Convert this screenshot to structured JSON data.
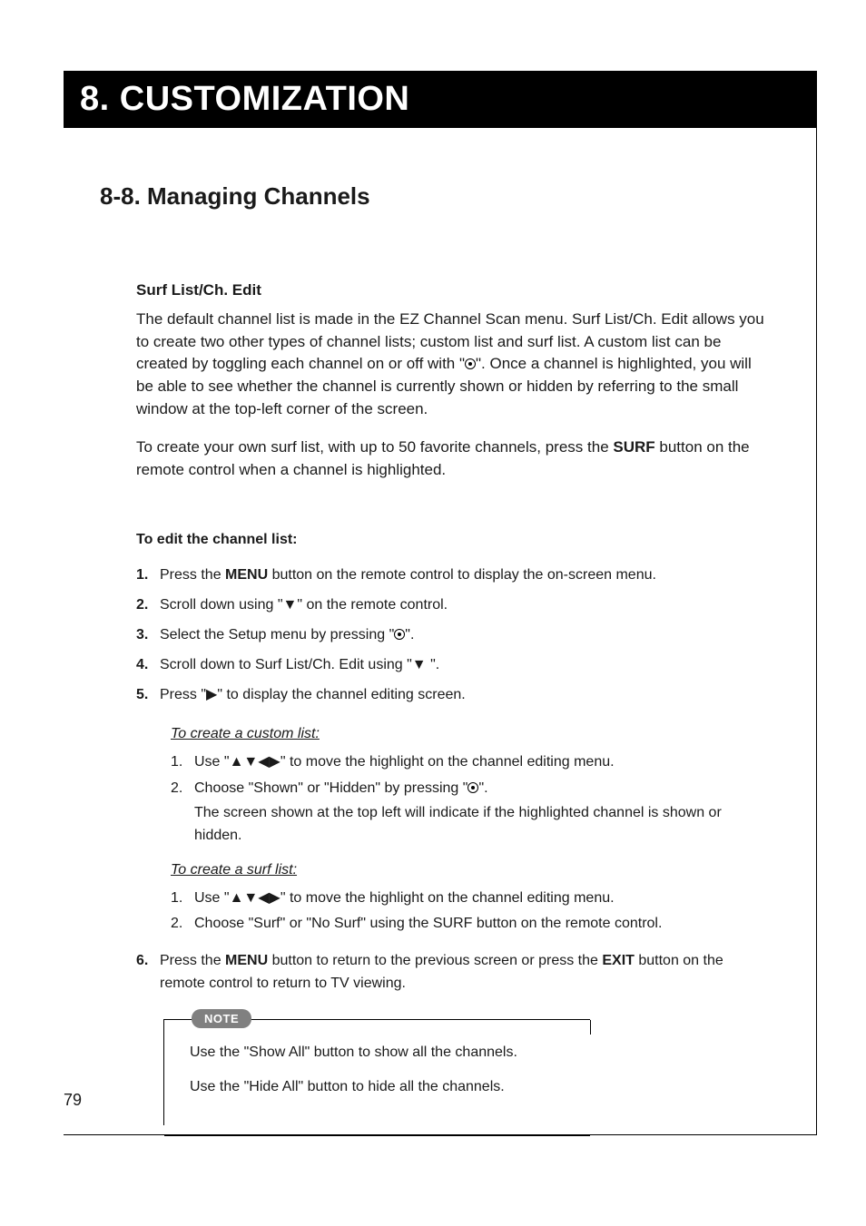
{
  "chapter": {
    "title": "8. CUSTOMIZATION"
  },
  "section": {
    "title": "8-8. Managing Channels"
  },
  "surf": {
    "heading": "Surf List/Ch. Edit",
    "p1a": "The default channel list is made in the EZ Channel Scan menu. Surf List/Ch. Edit allows you to create two other types of channel lists; custom list and surf list. A custom list can be created by toggling each channel on or off with \"",
    "p1b": "\". Once a channel is highlighted, you will be able to see whether the channel is currently shown or hidden by referring to the small window at the top-left corner of the screen.",
    "p2a": "To create your own surf list, with up to 50 favorite channels, press the ",
    "p2b": "SURF",
    "p2c": " button on the remote control when a channel is highlighted."
  },
  "edit": {
    "heading": "To edit the channel list:",
    "s1": {
      "n": "1.",
      "a": "Press the ",
      "b": "MENU",
      "c": " button on the remote control to display the on-screen menu."
    },
    "s2": {
      "n": "2.",
      "t": "Scroll down using \"▼\" on the remote control."
    },
    "s3": {
      "n": "3.",
      "a": "Select the Setup menu by pressing \"",
      "b": "\"."
    },
    "s4": {
      "n": "4.",
      "t": "Scroll down to Surf List/Ch. Edit using \"▼ \"."
    },
    "s5": {
      "n": "5.",
      "t": "Press \"▶\" to display the channel editing screen."
    },
    "s6": {
      "n": "6.",
      "a": "Press the ",
      "b": "MENU",
      "c": " button  to return to the previous screen or press the ",
      "d": "EXIT",
      "e": " button on the remote control to return to TV viewing."
    }
  },
  "custom": {
    "title": "To create a custom list:",
    "i1": {
      "n": "1.",
      "t": "Use \"▲▼◀▶\" to move the highlight on the channel editing menu."
    },
    "i2": {
      "n": "2.",
      "a": "Choose \"Shown\" or \"Hidden\" by pressing \"",
      "b": "\".",
      "line2": "The screen shown at the top left will indicate if the highlighted channel is shown or hidden."
    }
  },
  "surflist": {
    "title": "To create a surf list:",
    "i1": {
      "n": "1.",
      "t": "Use \"▲▼◀▶\" to move the highlight on the channel editing menu."
    },
    "i2": {
      "n": "2.",
      "a": "Choose \"Surf\" or \"No Surf\" using the ",
      "b": "SURF",
      "c": " button on the remote control."
    }
  },
  "note": {
    "badge": "NOTE",
    "l1": "Use the \"Show All\" button to show all the channels.",
    "l2": "Use the \"Hide All\" button to hide all the channels."
  },
  "page": {
    "num": "79"
  }
}
